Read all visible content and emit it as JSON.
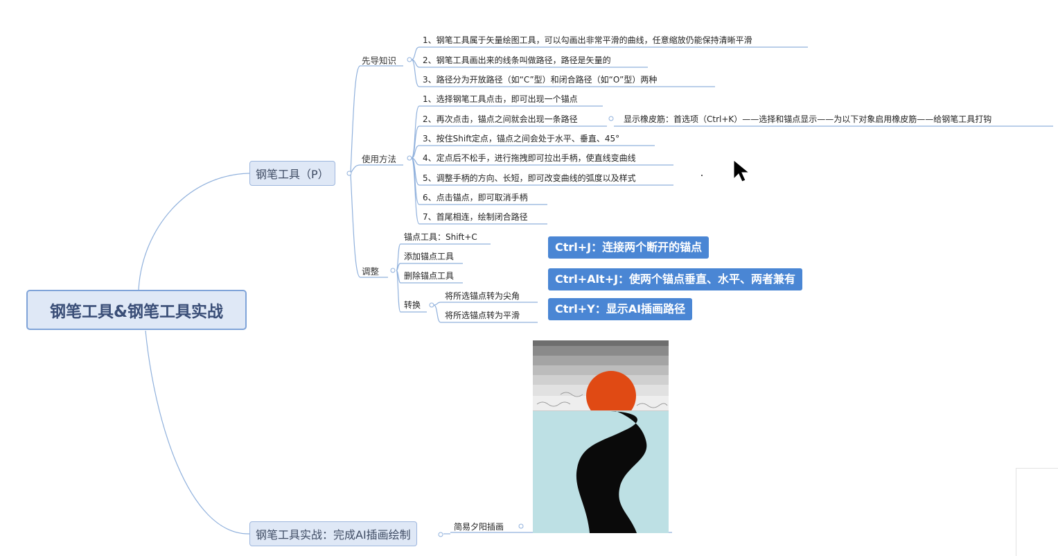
{
  "root": "钢笔工具&钢笔工具实战",
  "branch1": {
    "title": "钢笔工具（P）",
    "prereq": {
      "label": "先导知识",
      "items": [
        "1、钢笔工具属于矢量绘图工具，可以勾画出非常平滑的曲线，任意缩放仍能保持清晰平滑",
        "2、钢笔工具画出来的线条叫做路径，路径是矢量的",
        "3、路径分为开放路径（如“C”型）和闭合路径（如“O”型）两种"
      ]
    },
    "usage": {
      "label": "使用方法",
      "items": [
        "1、选择钢笔工具点击，即可出现一个锚点",
        "2、再次点击，锚点之间就会出现一条路径",
        "3、按住Shift定点，锚点之间会处于水平、垂直、45°",
        "4、定点后不松手，进行拖拽即可拉出手柄，使直线变曲线",
        "5、调整手柄的方向、长短，即可改变曲线的弧度以及样式",
        "6、点击锚点，即可取消手柄",
        "7、首尾相连，绘制闭合路径"
      ],
      "note": "显示橡皮筋：首选项（Ctrl+K）——选择和锚点显示——为以下对象启用橡皮筋——给钢笔工具打钩"
    },
    "adjust": {
      "label": "调整",
      "items": [
        "锚点工具：Shift+C",
        "添加锚点工具",
        "删除锚点工具"
      ],
      "convert": {
        "label": "转换",
        "items": [
          "将所选锚点转为尖角",
          "将所选锚点转为平滑"
        ]
      }
    }
  },
  "shortcuts": [
    "Ctrl+J：连接两个断开的锚点",
    "Ctrl+Alt+J：使两个锚点垂直、水平、两者兼有",
    "Ctrl+Y：显示AI插画路径"
  ],
  "branch2": {
    "title": "钢笔工具实战：完成AI插画绘制",
    "child": "简易夕阳插画"
  },
  "colors": {
    "accent": "#4a86d4",
    "node_fill": "#dfe8f6",
    "line": "#8fb0dc",
    "sun": "#e04a14",
    "water": "#bde0e4"
  }
}
